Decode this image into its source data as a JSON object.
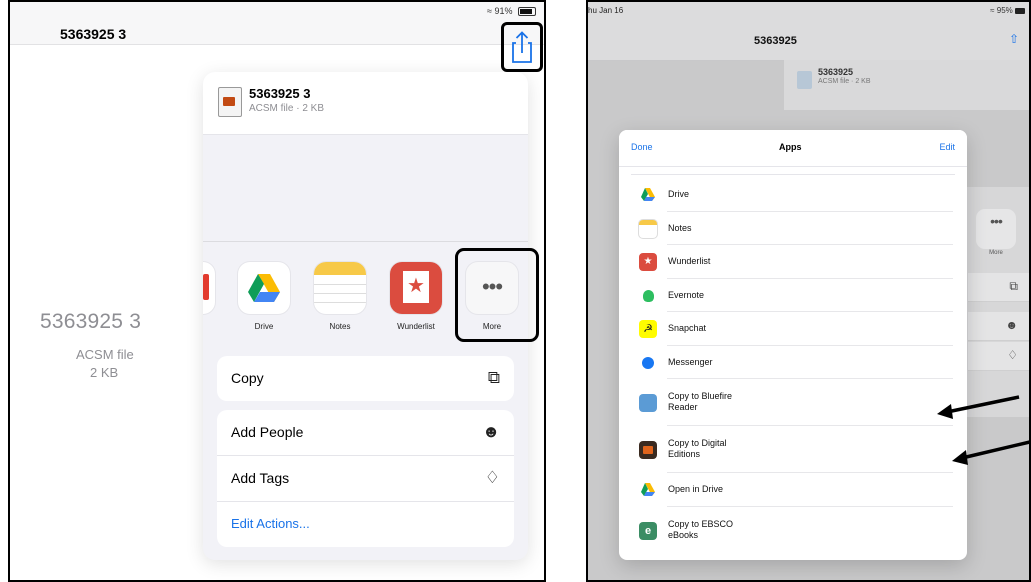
{
  "left_screen": {
    "status": "91%",
    "document_title": "5363925 3",
    "big_file_name": "5363925 3",
    "file_type": "ACSM file",
    "file_size": "2 KB",
    "share_sheet": {
      "filename": "5363925 3",
      "file_meta": "ACSM file · 2 KB",
      "apps": [
        {
          "label": "Drive",
          "icon": "google-drive-icon"
        },
        {
          "label": "Notes",
          "icon": "notes-icon"
        },
        {
          "label": "Wunderlist",
          "icon": "wunderlist-icon"
        },
        {
          "label": "More",
          "icon": "more-icon"
        }
      ],
      "actions_group1": [
        {
          "label": "Copy",
          "icon": "copy-icon"
        }
      ],
      "actions_group2": [
        {
          "label": "Add People",
          "icon": "add-people-icon"
        },
        {
          "label": "Add Tags",
          "icon": "tag-icon"
        }
      ],
      "edit_actions": "Edit Actions..."
    }
  },
  "right_screen": {
    "date": "hu Jan 16",
    "status": "95%",
    "document_title": "5363925",
    "background_file": {
      "filename": "5363925",
      "meta": "ACSM file · 2 KB"
    },
    "background_more_label": "More",
    "apps_modal": {
      "done": "Done",
      "title": "Apps",
      "edit": "Edit",
      "rows": [
        {
          "label": "Drive",
          "icon": "google-drive-icon"
        },
        {
          "label": "Notes",
          "icon": "notes-icon"
        },
        {
          "label": "Wunderlist",
          "icon": "wunderlist-icon"
        },
        {
          "label": "Evernote",
          "icon": "evernote-icon"
        },
        {
          "label": "Snapchat",
          "icon": "snapchat-icon"
        },
        {
          "label": "Messenger",
          "icon": "messenger-icon"
        },
        {
          "label": "Copy to Bluefire Reader",
          "icon": "bluefire-reader-icon"
        },
        {
          "label": "Copy to Digital Editions",
          "icon": "digital-editions-icon"
        },
        {
          "label": "Open in Drive",
          "icon": "google-drive-icon"
        },
        {
          "label": "Copy to EBSCO eBooks",
          "icon": "ebsco-icon"
        }
      ]
    }
  },
  "colors": {
    "link_blue": "#1a73e8",
    "sheet_bg": "#f2f2f7",
    "highlight_border": "#000000"
  }
}
